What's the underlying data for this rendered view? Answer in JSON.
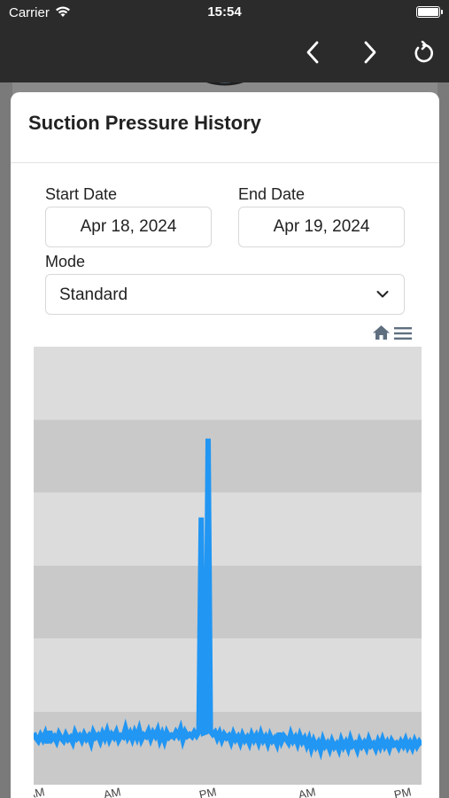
{
  "status_bar": {
    "carrier": "Carrier",
    "time": "15:54"
  },
  "nav": {
    "back_icon": "chevron-left-icon",
    "forward_icon": "chevron-right-icon",
    "reload_icon": "reload-icon"
  },
  "modal": {
    "title": "Suction Pressure History",
    "start_date": {
      "label": "Start Date",
      "value": "Apr 18, 2024"
    },
    "end_date": {
      "label": "End Date",
      "value": "Apr 19, 2024"
    },
    "mode": {
      "label": "Mode",
      "value": "Standard"
    },
    "toolbar": {
      "home_icon": "home-icon",
      "menu_icon": "menu-icon"
    }
  },
  "colors": {
    "topbar": "#2b2b2b",
    "series": "#2196f3",
    "band_light": "#dcdcdc",
    "band_dark": "#c9c9c9"
  },
  "chart_data": {
    "type": "line",
    "title": "",
    "xlabel": "",
    "ylabel": "",
    "bands": 6,
    "x_tick_labels": [
      "AM",
      "AM",
      "PM",
      "AM",
      "PM"
    ],
    "series": [
      {
        "values": [
          0.118,
          0.107,
          0.1,
          0.113,
          0.103,
          0.116,
          0.095,
          0.122,
          0.104,
          0.11,
          0.099,
          0.116,
          0.106,
          0.1,
          0.114,
          0.103,
          0.108,
          0.097,
          0.118,
          0.106,
          0.112,
          0.101,
          0.115,
          0.104,
          0.111,
          0.096,
          0.119,
          0.108,
          0.113,
          0.1,
          0.117,
          0.106,
          0.122,
          0.103,
          0.115,
          0.108,
          0.12,
          0.102,
          0.112,
          0.109,
          0.128,
          0.108,
          0.118,
          0.104,
          0.12,
          0.107,
          0.125,
          0.103,
          0.114,
          0.11,
          0.122,
          0.105,
          0.119,
          0.111,
          0.124,
          0.102,
          0.116,
          0.1,
          0.119,
          0.108,
          0.113,
          0.109,
          0.12,
          0.112,
          0.127,
          0.103,
          0.12,
          0.111,
          0.115,
          0.11,
          0.12,
          0.112,
          0.121,
          0.61,
          0.118,
          0.12,
          0.79,
          0.122,
          0.115,
          0.12,
          0.106,
          0.118,
          0.102,
          0.115,
          0.107,
          0.112,
          0.098,
          0.116,
          0.103,
          0.11,
          0.096,
          0.113,
          0.101,
          0.108,
          0.095,
          0.114,
          0.102,
          0.112,
          0.097,
          0.116,
          0.101,
          0.109,
          0.094,
          0.112,
          0.1,
          0.106,
          0.093,
          0.118,
          0.099,
          0.111,
          0.104,
          0.096,
          0.115,
          0.1,
          0.108,
          0.094,
          0.112,
          0.098,
          0.106,
          0.09,
          0.104,
          0.083,
          0.1,
          0.087,
          0.096,
          0.079,
          0.102,
          0.088,
          0.095,
          0.081,
          0.099,
          0.086,
          0.093,
          0.08,
          0.101,
          0.087,
          0.097,
          0.083,
          0.104,
          0.089,
          0.094,
          0.08,
          0.1,
          0.088,
          0.096,
          0.084,
          0.103,
          0.089,
          0.094,
          0.082,
          0.099,
          0.087,
          0.103,
          0.088,
          0.097,
          0.083,
          0.1,
          0.091,
          0.095,
          0.085,
          0.098,
          0.089,
          0.102,
          0.086,
          0.096,
          0.084,
          0.1,
          0.088,
          0.098,
          0.09
        ]
      }
    ]
  }
}
